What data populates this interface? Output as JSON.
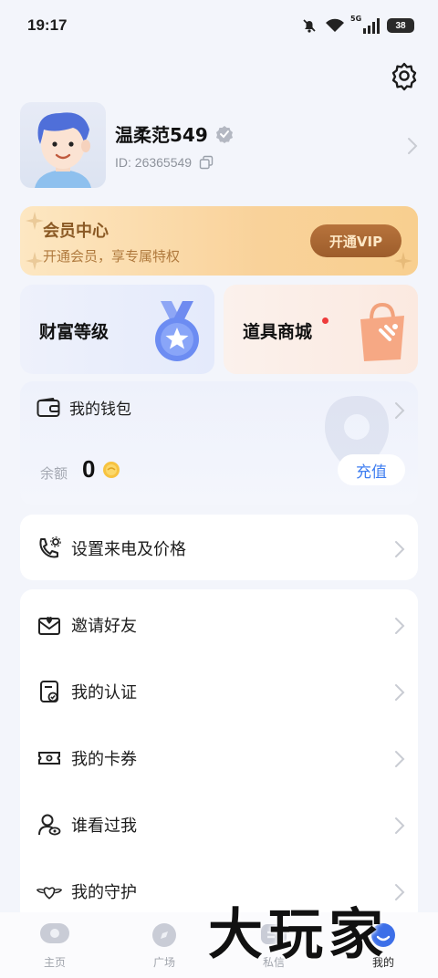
{
  "status_bar": {
    "time": "19:17",
    "network": "5G",
    "battery": "38"
  },
  "profile": {
    "name": "温柔范549",
    "id": "ID: 26365549"
  },
  "vip": {
    "title": "会员中心",
    "subtitle": "开通会员，享专属特权",
    "button": "开通VIP",
    "accent": "#9d5d2b"
  },
  "tiles": {
    "wealth": "财富等级",
    "shop": "道具商城"
  },
  "wallet": {
    "title": "我的钱包",
    "balance_label": "余额",
    "balance": "0",
    "recharge": "充值"
  },
  "menu_top": {
    "call_settings": "设置来电及价格"
  },
  "menu": [
    {
      "icon": "invite-mail-icon",
      "label": "邀请好友"
    },
    {
      "icon": "certification-icon",
      "label": "我的认证"
    },
    {
      "icon": "ticket-icon",
      "label": "我的卡券"
    },
    {
      "icon": "visitor-icon",
      "label": "谁看过我"
    },
    {
      "icon": "guard-wings-icon",
      "label": "我的守护"
    }
  ],
  "nav": [
    {
      "icon": "home-chat-icon",
      "label": "主页"
    },
    {
      "icon": "compass-icon",
      "label": "广场"
    },
    {
      "icon": "message-icon",
      "label": "私信"
    },
    {
      "icon": "profile-icon",
      "label": "我的",
      "active": true
    }
  ],
  "watermark": "大玩家"
}
